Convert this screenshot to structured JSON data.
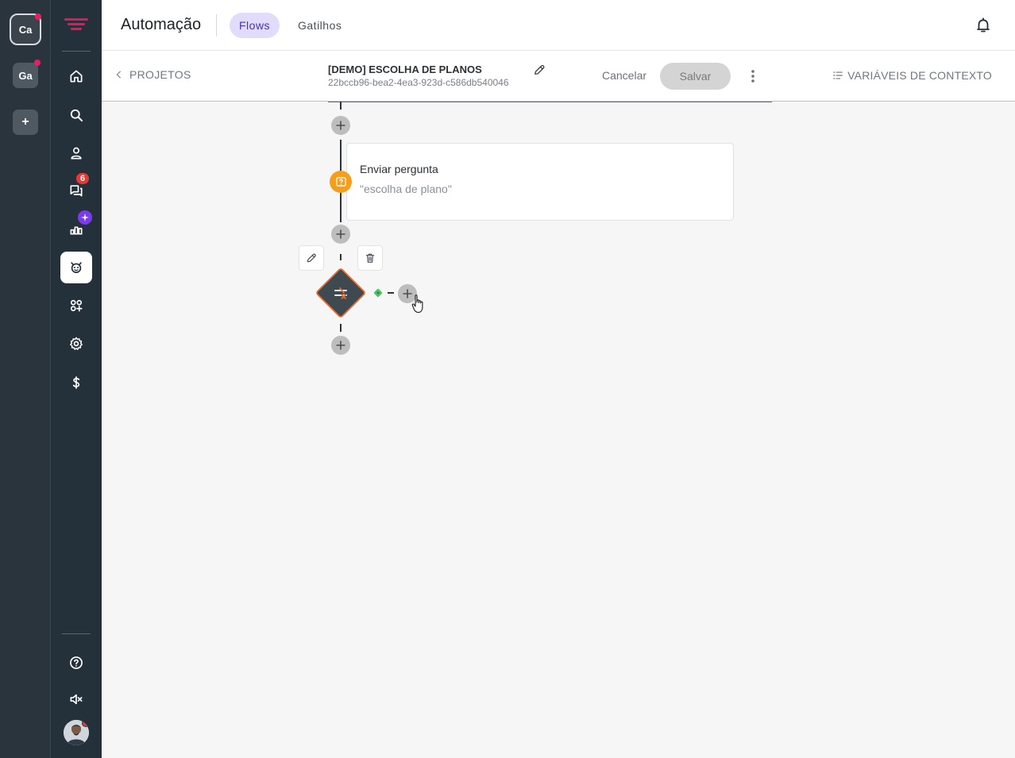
{
  "workspaces": [
    {
      "label": "Ca",
      "active": true
    },
    {
      "label": "Ga",
      "active": false
    }
  ],
  "workspace_add_label": "+",
  "nav": {
    "badges": {
      "chats": "6"
    },
    "items": [
      "home-icon",
      "search-icon",
      "contacts-icon",
      "chats-icon",
      "reports-icon",
      "automation-icon",
      "apps-icon",
      "settings-icon",
      "billing-icon",
      "help-icon",
      "mute-icon"
    ]
  },
  "header": {
    "title": "Automação",
    "tabs": [
      {
        "label": "Flows",
        "active": true
      },
      {
        "label": "Gatilhos",
        "active": false
      }
    ]
  },
  "subheader": {
    "back_label": "PROJETOS",
    "flow_name": "[DEMO] ESCOLHA DE PLANOS",
    "flow_id": "22bccb96-bea2-4ea3-923d-c586db540046",
    "cancel_label": "Cancelar",
    "save_label": "Salvar",
    "context_vars_label": "VARIÁVEIS DE CONTEXTO"
  },
  "canvas": {
    "question_node": {
      "title": "Enviar pergunta",
      "subtitle": "\"escolha de plano\""
    }
  },
  "colors": {
    "rail_bg": "#2a343d",
    "nav_bg": "#24303a",
    "accent": "#4a2fb8",
    "tab_active_bg": "#e2dcfb",
    "question_icon": "#f59e1b",
    "condition_node": "#3f4950",
    "condition_border": "#e86a2c",
    "condition_true": "#4cc46e",
    "badge_red": "#e53935",
    "badge_purple": "#7c3aed"
  }
}
